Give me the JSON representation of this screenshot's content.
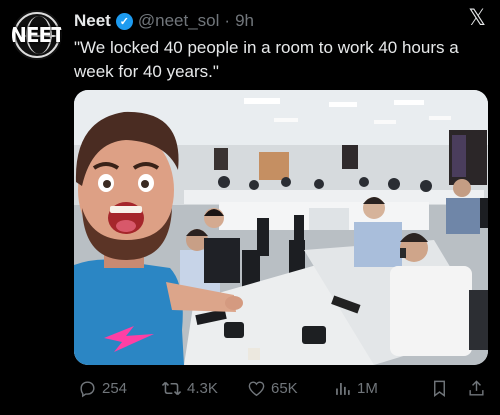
{
  "author": {
    "avatar_text": "NEET",
    "name": "Neet",
    "handle": "@neet_sol",
    "separator": "·",
    "time": "9h"
  },
  "tweet": {
    "text": "\"We locked 40 people in a room to work 40 hours a week for 40 years.\""
  },
  "actions": {
    "replies": "254",
    "retweets": "4.3K",
    "likes": "65K",
    "views": "1M"
  },
  "icons": {
    "x": "x-logo-icon",
    "verified": "verified-badge-icon",
    "reply": "reply-icon",
    "retweet": "retweet-icon",
    "like": "heart-icon",
    "views": "views-icon",
    "bookmark": "bookmark-icon",
    "share": "share-icon"
  },
  "colors": {
    "background": "#000000",
    "text": "#e7e9ea",
    "secondary_text": "#71767b",
    "verified": "#1d9bf0"
  }
}
